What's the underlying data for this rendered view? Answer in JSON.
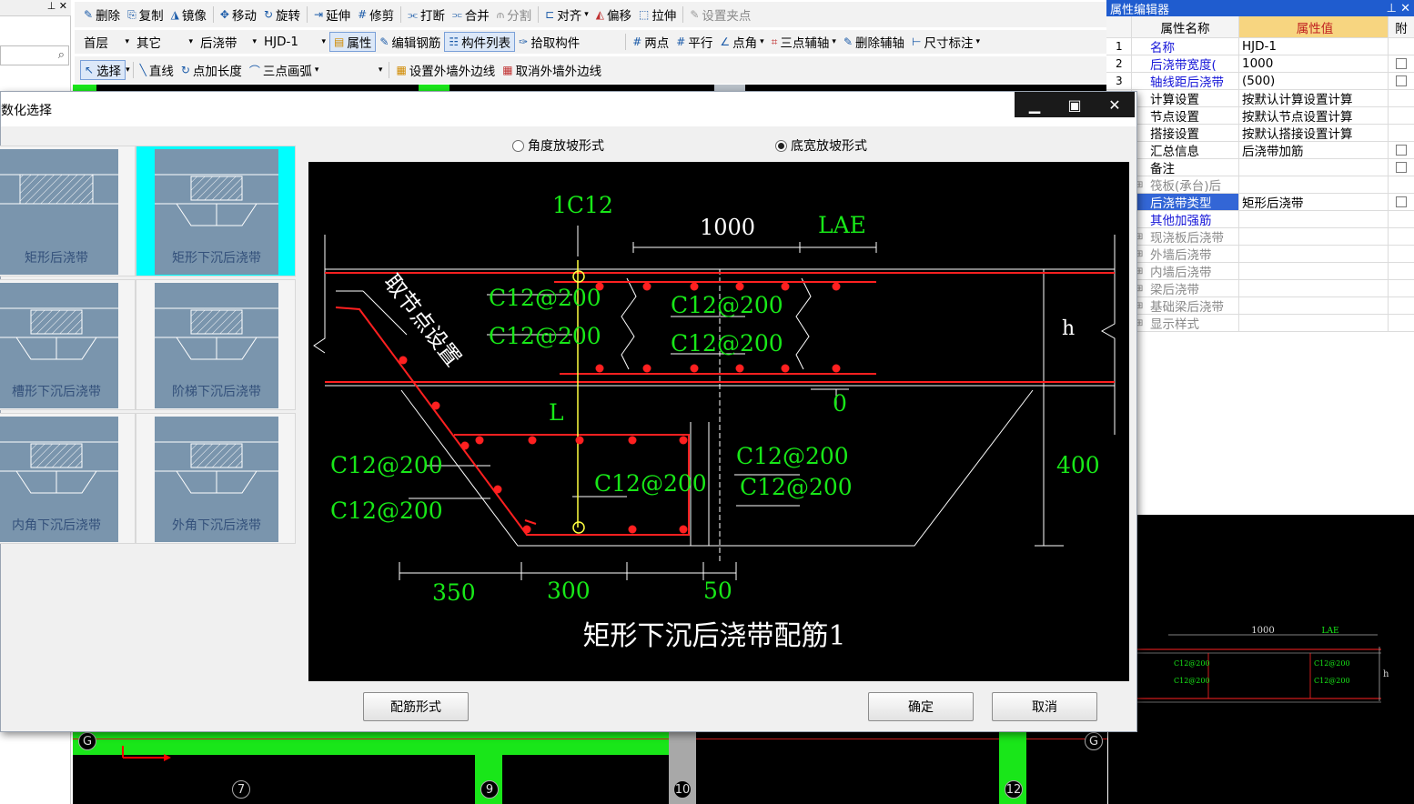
{
  "toolbar1": {
    "delete": "删除",
    "copy": "复制",
    "mirror": "镜像",
    "move": "移动",
    "rotate": "旋转",
    "extend": "延伸",
    "trim": "修剪",
    "break": "打断",
    "merge": "合并",
    "split": "分割",
    "align": "对齐",
    "offset": "偏移",
    "stretch": "拉伸",
    "set_grip": "设置夹点"
  },
  "toolbar2": {
    "floor": "首层",
    "category": "其它",
    "type": "后浇带",
    "component": "HJD-1",
    "properties": "属性",
    "edit_rebar": "编辑钢筋",
    "component_list": "构件列表",
    "pick": "拾取构件",
    "two_points": "两点",
    "parallel": "平行",
    "point_angle": "点角",
    "three_point_aux": "三点辅轴",
    "delete_aux": "删除辅轴",
    "dimension": "尺寸标注"
  },
  "toolbar3": {
    "select": "选择",
    "line": "直线",
    "point_length": "点加长度",
    "three_point_arc": "三点画弧",
    "set_outer_wall": "设置外墙外边线",
    "cancel_outer_wall": "取消外墙外边线"
  },
  "property_editor": {
    "title": "属性编辑器",
    "col_name": "属性名称",
    "col_value": "属性值",
    "col_attach": "附",
    "rows": [
      {
        "num": "1",
        "name": "名称",
        "value": "HJD-1"
      },
      {
        "num": "2",
        "name": "后浇带宽度(",
        "value": "1000"
      },
      {
        "num": "3",
        "name": "轴线距后浇带",
        "value": "(500)"
      },
      {
        "num": "",
        "name": "计算设置",
        "value": "按默认计算设置计算"
      },
      {
        "num": "",
        "name": "节点设置",
        "value": "按默认节点设置计算"
      },
      {
        "num": "",
        "name": "搭接设置",
        "value": "按默认搭接设置计算"
      },
      {
        "num": "",
        "name": "汇总信息",
        "value": "后浇带加筋"
      },
      {
        "num": "",
        "name": "备注",
        "value": ""
      },
      {
        "num": "",
        "name": "筏板(承台)后",
        "value": ""
      },
      {
        "num": "",
        "name": "后浇带类型",
        "value": "矩形后浇带"
      },
      {
        "num": "",
        "name": "其他加强筋",
        "value": ""
      },
      {
        "num": "",
        "name": "现浇板后浇带",
        "value": ""
      },
      {
        "num": "",
        "name": "外墙后浇带",
        "value": ""
      },
      {
        "num": "",
        "name": "内墙后浇带",
        "value": ""
      },
      {
        "num": "",
        "name": "梁后浇带",
        "value": ""
      },
      {
        "num": "",
        "name": "基础梁后浇带",
        "value": ""
      },
      {
        "num": "",
        "name": "显示样式",
        "value": ""
      }
    ]
  },
  "dialog": {
    "title": "数化选择",
    "radio_angle": "角度放坡形式",
    "radio_width": "底宽放坡形式",
    "btn_rebar": "配筋形式",
    "btn_ok": "确定",
    "btn_cancel": "取消",
    "thumbs": [
      {
        "label": "矩形后浇带"
      },
      {
        "label": "矩形下沉后浇带"
      },
      {
        "label": "槽形下沉后浇带"
      },
      {
        "label": "阶梯下沉后浇带"
      },
      {
        "label": "内角下沉后浇带"
      },
      {
        "label": "外角下沉后浇带"
      }
    ]
  },
  "drawing": {
    "top_bar": "1C12",
    "dim_1000": "1000",
    "dim_lae": "LAE",
    "node_setting": "取节点设置",
    "rebar_a": "C12@200",
    "rebar_b": "C12@200",
    "rebar_c": "C12@200",
    "rebar_d": "C12@200",
    "rebar_e": "C12@200",
    "rebar_f": "C12@200",
    "rebar_g": "C12@200",
    "rebar_h": "C12@200",
    "rebar_i": "C12@200",
    "label_h": "h",
    "label_0": "0",
    "label_L": "L",
    "dim_400": "400",
    "dim_350": "350",
    "dim_300": "300",
    "dim_50": "50",
    "caption": "矩形下沉后浇带配筋1"
  },
  "preview": {
    "dim_1000": "1000",
    "dim_lae": "LAE",
    "r1": "C12@200",
    "r2": "C12@200",
    "r3": "C12@200",
    "r4": "C12@200",
    "label_h": "h"
  },
  "axes": {
    "a7": "7",
    "a9": "9",
    "a10": "10",
    "a12": "12",
    "g_left": "G",
    "g_right": "G"
  },
  "colors": {
    "accent": "#1f5ccf",
    "cad_green": "#19e619",
    "rebar_red": "#ff2020",
    "text_green": "#18e818"
  }
}
